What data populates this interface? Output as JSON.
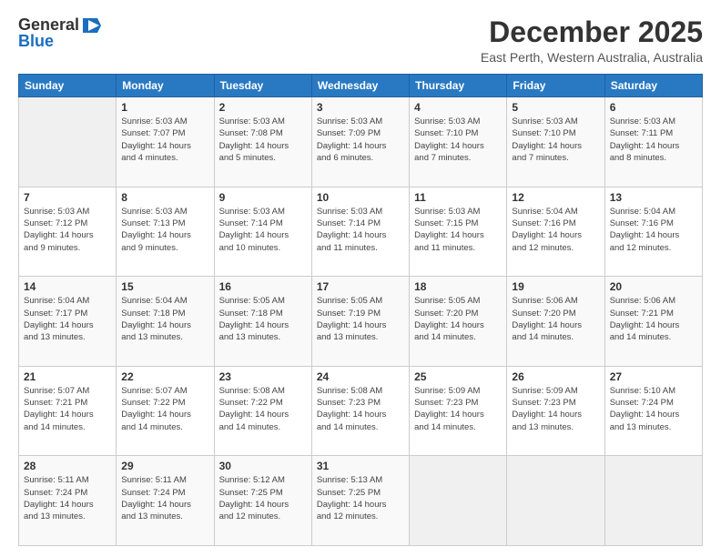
{
  "header": {
    "logo_general": "General",
    "logo_blue": "Blue",
    "month_title": "December 2025",
    "location": "East Perth, Western Australia, Australia"
  },
  "weekdays": [
    "Sunday",
    "Monday",
    "Tuesday",
    "Wednesday",
    "Thursday",
    "Friday",
    "Saturday"
  ],
  "weeks": [
    [
      {
        "day": "",
        "info": ""
      },
      {
        "day": "1",
        "info": "Sunrise: 5:03 AM\nSunset: 7:07 PM\nDaylight: 14 hours\nand 4 minutes."
      },
      {
        "day": "2",
        "info": "Sunrise: 5:03 AM\nSunset: 7:08 PM\nDaylight: 14 hours\nand 5 minutes."
      },
      {
        "day": "3",
        "info": "Sunrise: 5:03 AM\nSunset: 7:09 PM\nDaylight: 14 hours\nand 6 minutes."
      },
      {
        "day": "4",
        "info": "Sunrise: 5:03 AM\nSunset: 7:10 PM\nDaylight: 14 hours\nand 7 minutes."
      },
      {
        "day": "5",
        "info": "Sunrise: 5:03 AM\nSunset: 7:10 PM\nDaylight: 14 hours\nand 7 minutes."
      },
      {
        "day": "6",
        "info": "Sunrise: 5:03 AM\nSunset: 7:11 PM\nDaylight: 14 hours\nand 8 minutes."
      }
    ],
    [
      {
        "day": "7",
        "info": ""
      },
      {
        "day": "8",
        "info": "Sunrise: 5:03 AM\nSunset: 7:13 PM\nDaylight: 14 hours\nand 9 minutes."
      },
      {
        "day": "9",
        "info": "Sunrise: 5:03 AM\nSunset: 7:14 PM\nDaylight: 14 hours\nand 10 minutes."
      },
      {
        "day": "10",
        "info": "Sunrise: 5:03 AM\nSunset: 7:14 PM\nDaylight: 14 hours\nand 11 minutes."
      },
      {
        "day": "11",
        "info": "Sunrise: 5:03 AM\nSunset: 7:15 PM\nDaylight: 14 hours\nand 11 minutes."
      },
      {
        "day": "12",
        "info": "Sunrise: 5:04 AM\nSunset: 7:16 PM\nDaylight: 14 hours\nand 12 minutes."
      },
      {
        "day": "13",
        "info": "Sunrise: 5:04 AM\nSunset: 7:16 PM\nDaylight: 14 hours\nand 12 minutes."
      }
    ],
    [
      {
        "day": "14",
        "info": ""
      },
      {
        "day": "15",
        "info": "Sunrise: 5:04 AM\nSunset: 7:18 PM\nDaylight: 14 hours\nand 13 minutes."
      },
      {
        "day": "16",
        "info": "Sunrise: 5:05 AM\nSunset: 7:18 PM\nDaylight: 14 hours\nand 13 minutes."
      },
      {
        "day": "17",
        "info": "Sunrise: 5:05 AM\nSunset: 7:19 PM\nDaylight: 14 hours\nand 13 minutes."
      },
      {
        "day": "18",
        "info": "Sunrise: 5:05 AM\nSunset: 7:20 PM\nDaylight: 14 hours\nand 14 minutes."
      },
      {
        "day": "19",
        "info": "Sunrise: 5:06 AM\nSunset: 7:20 PM\nDaylight: 14 hours\nand 14 minutes."
      },
      {
        "day": "20",
        "info": "Sunrise: 5:06 AM\nSunset: 7:21 PM\nDaylight: 14 hours\nand 14 minutes."
      }
    ],
    [
      {
        "day": "21",
        "info": ""
      },
      {
        "day": "22",
        "info": "Sunrise: 5:07 AM\nSunset: 7:22 PM\nDaylight: 14 hours\nand 14 minutes."
      },
      {
        "day": "23",
        "info": "Sunrise: 5:08 AM\nSunset: 7:22 PM\nDaylight: 14 hours\nand 14 minutes."
      },
      {
        "day": "24",
        "info": "Sunrise: 5:08 AM\nSunset: 7:23 PM\nDaylight: 14 hours\nand 14 minutes."
      },
      {
        "day": "25",
        "info": "Sunrise: 5:09 AM\nSunset: 7:23 PM\nDaylight: 14 hours\nand 14 minutes."
      },
      {
        "day": "26",
        "info": "Sunrise: 5:09 AM\nSunset: 7:23 PM\nDaylight: 14 hours\nand 13 minutes."
      },
      {
        "day": "27",
        "info": "Sunrise: 5:10 AM\nSunset: 7:24 PM\nDaylight: 14 hours\nand 13 minutes."
      }
    ],
    [
      {
        "day": "28",
        "info": "Sunrise: 5:11 AM\nSunset: 7:24 PM\nDaylight: 14 hours\nand 13 minutes."
      },
      {
        "day": "29",
        "info": "Sunrise: 5:11 AM\nSunset: 7:24 PM\nDaylight: 14 hours\nand 13 minutes."
      },
      {
        "day": "30",
        "info": "Sunrise: 5:12 AM\nSunset: 7:25 PM\nDaylight: 14 hours\nand 12 minutes."
      },
      {
        "day": "31",
        "info": "Sunrise: 5:13 AM\nSunset: 7:25 PM\nDaylight: 14 hours\nand 12 minutes."
      },
      {
        "day": "",
        "info": ""
      },
      {
        "day": "",
        "info": ""
      },
      {
        "day": "",
        "info": ""
      }
    ]
  ],
  "week1_day7_info": "Sunrise: 5:03 AM\nSunset: 7:12 PM\nDaylight: 14 hours\nand 9 minutes.",
  "week3_day14_info": "Sunrise: 5:04 AM\nSunset: 7:17 PM\nDaylight: 14 hours\nand 13 minutes.",
  "week4_day21_info": "Sunrise: 5:07 AM\nSunset: 7:21 PM\nDaylight: 14 hours\nand 14 minutes."
}
